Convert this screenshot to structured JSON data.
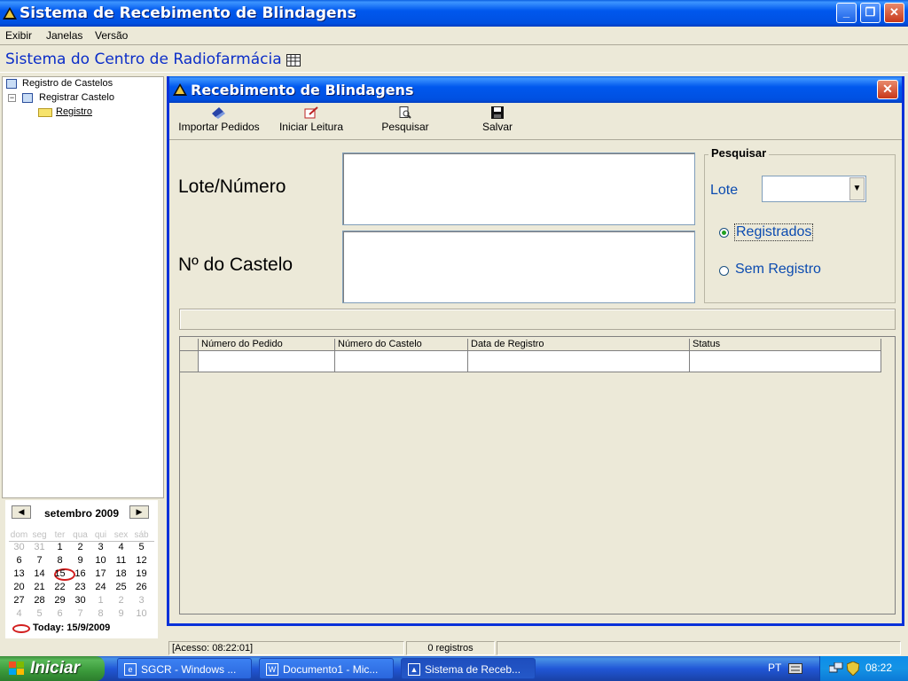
{
  "window": {
    "title": "Sistema de Recebimento de Blindagens"
  },
  "menu": [
    "Exibir",
    "Janelas",
    "Versão"
  ],
  "header": {
    "title": "Sistema do Centro de Radiofarmácia"
  },
  "tree": {
    "items": [
      "Registro de Castelos",
      "Registrar Castelo",
      "Registro"
    ]
  },
  "calendar": {
    "month": "setembro 2009",
    "dow": [
      "dom",
      "seg",
      "ter",
      "qua",
      "qui",
      "sex",
      "sáb"
    ],
    "weeks": [
      [
        "30",
        "31",
        "1",
        "2",
        "3",
        "4",
        "5"
      ],
      [
        "6",
        "7",
        "8",
        "9",
        "10",
        "11",
        "12"
      ],
      [
        "13",
        "14",
        "15",
        "16",
        "17",
        "18",
        "19"
      ],
      [
        "20",
        "21",
        "22",
        "23",
        "24",
        "25",
        "26"
      ],
      [
        "27",
        "28",
        "29",
        "30",
        "1",
        "2",
        "3"
      ],
      [
        "4",
        "5",
        "6",
        "7",
        "8",
        "9",
        "10"
      ]
    ],
    "today_label": "Today: 15/9/2009"
  },
  "child": {
    "title": "Recebimento de Blindagens",
    "toolbar": {
      "import": "Importar Pedidos",
      "start": "Iniciar Leitura",
      "search": "Pesquisar",
      "save": "Salvar"
    },
    "form": {
      "lote_label": "Lote/Número",
      "castelo_label": "Nº do Castelo"
    },
    "search_group": {
      "legend": "Pesquisar",
      "lote": "Lote",
      "opt_registered": "Registrados",
      "opt_unregistered": "Sem Registro"
    },
    "grid": {
      "columns": [
        "Número do Pedido",
        "Número do Castelo",
        "Data de Registro",
        "Status"
      ]
    }
  },
  "status": {
    "access": "[Acesso: 08:22:01]",
    "records": "0 registros"
  },
  "taskbar": {
    "start": "Iniciar",
    "tasks": [
      "SGCR - Windows ...",
      "Documento1 - Mic...",
      "Sistema de Receb..."
    ],
    "lang": "PT",
    "clock": "08:22"
  },
  "colors": {
    "titlebar": "#0058EE",
    "header_text": "#0B2DC8",
    "search_text": "#0B4BB0",
    "today_circle": "#D21E1E"
  }
}
